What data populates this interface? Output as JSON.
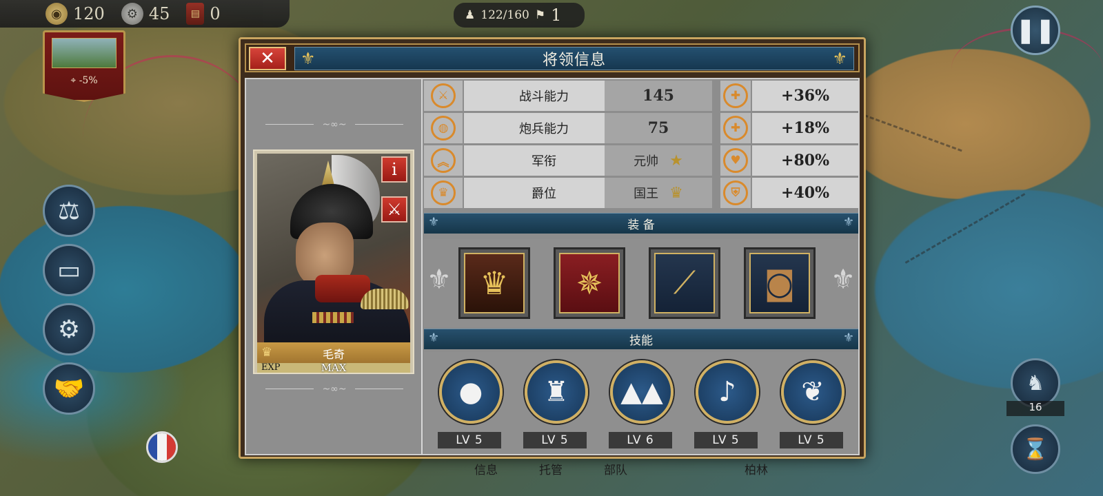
{
  "topbar": {
    "gold": "120",
    "gears": "45",
    "books": "0"
  },
  "troops": {
    "capacity": "122/160",
    "count": "1"
  },
  "terrain": {
    "modifier": "-5%"
  },
  "unit_counter": "16",
  "bottom_tabs": [
    "信息",
    "托管",
    "部队",
    "柏林"
  ],
  "dialog": {
    "title": "将领信息",
    "close_symbol": "✕",
    "general": {
      "name": "毛奇",
      "exp_label": "EXP",
      "exp_value": "MAX",
      "info_label": "i"
    },
    "stats": [
      {
        "label": "战斗能力",
        "value": "145",
        "bonus": "+36%",
        "icon": "crossed-swords-icon",
        "bonus_icon": "attack-bonus-icon"
      },
      {
        "label": "炮兵能力",
        "value": "75",
        "bonus": "+18%",
        "icon": "cannon-icon",
        "bonus_icon": "artillery-bonus-icon"
      },
      {
        "label": "军衔",
        "value": "元帅",
        "bonus": "+80%",
        "icon": "rank-chevron-icon",
        "bonus_icon": "morale-heart-icon"
      },
      {
        "label": "爵位",
        "value": "国王",
        "bonus": "+40%",
        "icon": "nobility-crown-icon",
        "bonus_icon": "defense-shield-icon"
      }
    ],
    "equipment_title": "装 备",
    "equipment": [
      {
        "icon": "crown-icon"
      },
      {
        "icon": "medal-icon"
      },
      {
        "icon": "telescope-icon"
      },
      {
        "icon": "supply-barrels-icon"
      }
    ],
    "skills_title": "技能",
    "skills": [
      {
        "icon": "bomb-icon",
        "level": "LV 5"
      },
      {
        "icon": "fortress-icon",
        "level": "LV 5"
      },
      {
        "icon": "spikes-icon",
        "level": "LV 6"
      },
      {
        "icon": "bugle-icon",
        "level": "LV 5"
      },
      {
        "icon": "feather-icon",
        "level": "LV 5"
      }
    ]
  },
  "colors": {
    "accent_blue": "#1f4762",
    "gold_trim": "#c9a560",
    "close_red": "#c2342a",
    "icon_orange": "#d98a2c"
  }
}
